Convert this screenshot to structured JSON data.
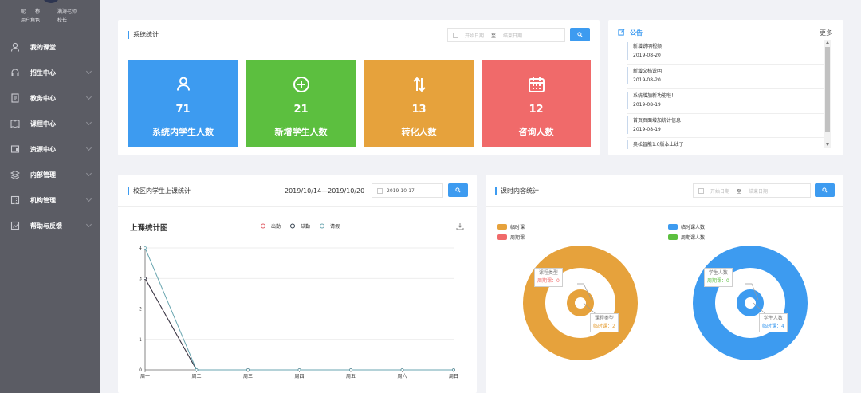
{
  "profile": {
    "nickname_label": "昵　　称：",
    "nickname": "满涛老师",
    "role_label": "用户角色：",
    "role": "校长"
  },
  "menu": [
    {
      "label": "我的课堂",
      "icon": "user-icon"
    },
    {
      "label": "招生中心",
      "icon": "headset-icon"
    },
    {
      "label": "教务中心",
      "icon": "document-icon"
    },
    {
      "label": "课程中心",
      "icon": "book-icon"
    },
    {
      "label": "资源中心",
      "icon": "folder-icon"
    },
    {
      "label": "内部管理",
      "icon": "layers-icon"
    },
    {
      "label": "机构管理",
      "icon": "building-icon"
    },
    {
      "label": "帮助与反馈",
      "icon": "feedback-icon"
    }
  ],
  "stats": {
    "title": "系统统计",
    "start_placeholder": "开始日期",
    "end_placeholder": "结束日期",
    "to": "至",
    "tiles": [
      {
        "value": "71",
        "label": "系统内学生人数",
        "color": "#3d9bf0",
        "icon": "user-icon"
      },
      {
        "value": "21",
        "label": "新增学生人数",
        "color": "#5cbf3f",
        "icon": "plus-circle-icon"
      },
      {
        "value": "13",
        "label": "转化人数",
        "color": "#e6a23c",
        "icon": "swap-icon"
      },
      {
        "value": "12",
        "label": "咨询人数",
        "color": "#f06a6a",
        "icon": "calendar-icon"
      }
    ]
  },
  "notice": {
    "title": "公告",
    "more": "更多",
    "items": [
      {
        "title": "新增说明视频",
        "date": "2019-08-20"
      },
      {
        "title": "新增文档说明",
        "date": "2019-08-20"
      },
      {
        "title": "系统增加新功能啦！",
        "date": "2019-08-19"
      },
      {
        "title": "首页页面增加统计信息",
        "date": "2019-08-19"
      },
      {
        "title": "奥松智能1.0版本上线了",
        "date": ""
      }
    ]
  },
  "attendance": {
    "title": "校区内学生上课统计",
    "range": "2019/10/14—2019/10/20",
    "date": "2019-10-17"
  },
  "hours": {
    "title": "课时内容统计",
    "start_placeholder": "开始日期",
    "end_placeholder": "结束日期",
    "to": "至"
  },
  "chart_data": [
    {
      "type": "line",
      "title": "上课统计图",
      "categories": [
        "周一",
        "周二",
        "周三",
        "周四",
        "周五",
        "周六",
        "周日"
      ],
      "series": [
        {
          "name": "出勤",
          "values": [
            3,
            0,
            0,
            0,
            0,
            0,
            0
          ],
          "color": "#e05b63"
        },
        {
          "name": "缺勤",
          "values": [
            3,
            0,
            0,
            0,
            0,
            0,
            0
          ],
          "color": "#2f3c4a"
        },
        {
          "name": "请假",
          "values": [
            4,
            0,
            0,
            0,
            0,
            0,
            0
          ],
          "color": "#6aa6b0"
        }
      ],
      "yticks": [
        "0",
        "1",
        "2",
        "3",
        "4"
      ],
      "ylim": [
        0,
        4
      ]
    },
    {
      "type": "pie",
      "legend": [
        {
          "name": "临时课",
          "color": "#e6a23c"
        },
        {
          "name": "周期课",
          "color": "#f06a6a"
        }
      ],
      "tooltips": [
        {
          "title": "课程类型",
          "text": "周期课：0",
          "color": "#f06a6a"
        },
        {
          "title": "课程类型",
          "text": "临时课：2",
          "color": "#e6a23c"
        }
      ],
      "values": [
        {
          "name": "临时课",
          "value": 2
        },
        {
          "name": "周期课",
          "value": 0
        }
      ]
    },
    {
      "type": "pie",
      "legend": [
        {
          "name": "临时课人数",
          "color": "#3d9bf0"
        },
        {
          "name": "周期课人数",
          "color": "#5cbf3f"
        }
      ],
      "tooltips": [
        {
          "title": "学生人数",
          "text": "周期课：0",
          "color": "#5cbf3f"
        },
        {
          "title": "学生人数",
          "text": "临时课：4",
          "color": "#3d9bf0"
        }
      ],
      "values": [
        {
          "name": "临时课人数",
          "value": 4
        },
        {
          "name": "周期课人数",
          "value": 0
        }
      ]
    }
  ]
}
